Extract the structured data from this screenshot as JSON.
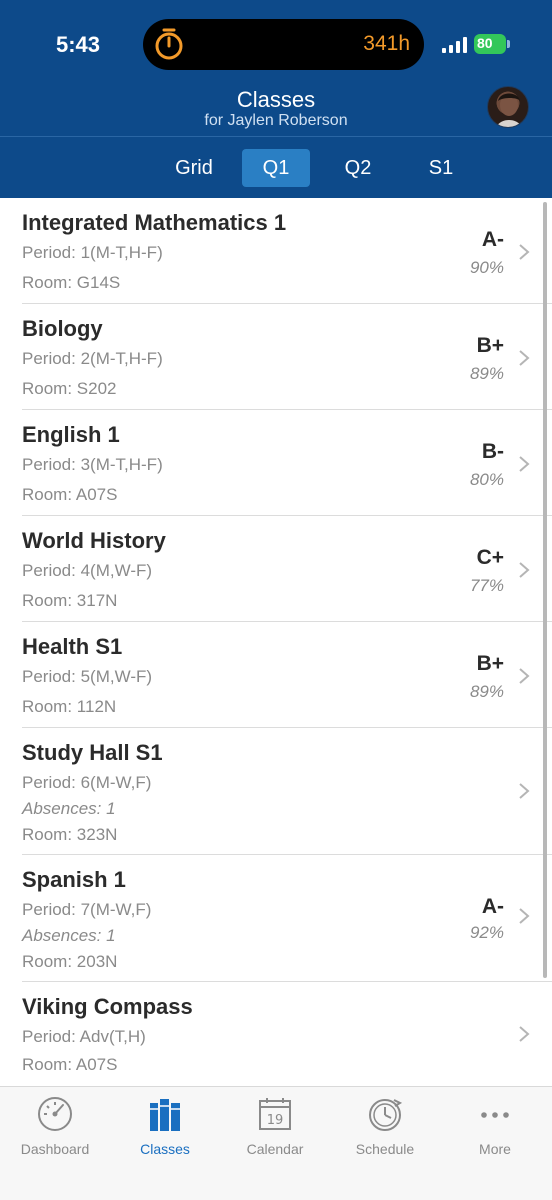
{
  "status_bar": {
    "time": "5:43",
    "timer_text": "341h",
    "battery": "80"
  },
  "header": {
    "title": "Classes",
    "subtitle": "for Jaylen Roberson"
  },
  "tabs": [
    {
      "label": "Grid",
      "active": false
    },
    {
      "label": "Q1",
      "active": true
    },
    {
      "label": "Q2",
      "active": false
    },
    {
      "label": "S1",
      "active": false
    }
  ],
  "classes": [
    {
      "name": "Integrated Mathematics 1",
      "period": "Period: 1(M-T,H-F)",
      "absences": "",
      "room": "Room: G14S",
      "grade": "A-",
      "percent": "90%"
    },
    {
      "name": "Biology",
      "period": "Period: 2(M-T,H-F)",
      "absences": "",
      "room": "Room: S202",
      "grade": "B+",
      "percent": "89%"
    },
    {
      "name": "English 1",
      "period": "Period: 3(M-T,H-F)",
      "absences": "",
      "room": "Room: A07S",
      "grade": "B-",
      "percent": "80%"
    },
    {
      "name": "World History",
      "period": "Period: 4(M,W-F)",
      "absences": "",
      "room": "Room: 317N",
      "grade": "C+",
      "percent": "77%"
    },
    {
      "name": "Health S1",
      "period": "Period: 5(M,W-F)",
      "absences": "",
      "room": "Room: 112N",
      "grade": "B+",
      "percent": "89%"
    },
    {
      "name": "Study Hall S1",
      "period": "Period: 6(M-W,F)",
      "absences": "Absences: 1",
      "room": "Room: 323N",
      "grade": "",
      "percent": ""
    },
    {
      "name": "Spanish 1",
      "period": "Period: 7(M-W,F)",
      "absences": "Absences: 1",
      "room": "Room: 203N",
      "grade": "A-",
      "percent": "92%"
    },
    {
      "name": "Viking Compass",
      "period": "Period: Adv(T,H)",
      "absences": "",
      "room": "Room: A07S",
      "grade": "",
      "percent": ""
    }
  ],
  "tabbar": [
    {
      "label": "Dashboard",
      "icon": "gauge-icon",
      "active": false
    },
    {
      "label": "Classes",
      "icon": "books-icon",
      "active": true
    },
    {
      "label": "Calendar",
      "icon": "calendar-icon",
      "active": false,
      "calendar_day": "19"
    },
    {
      "label": "Schedule",
      "icon": "clock-icon",
      "active": false
    },
    {
      "label": "More",
      "icon": "ellipsis-icon",
      "active": false
    }
  ],
  "colors": {
    "header_bg": "#0d4a8a",
    "active_tab_bg": "#2a7fc4",
    "active_tabbar": "#1a6fc0",
    "timer": "#f39a2a",
    "battery": "#33c75a"
  }
}
